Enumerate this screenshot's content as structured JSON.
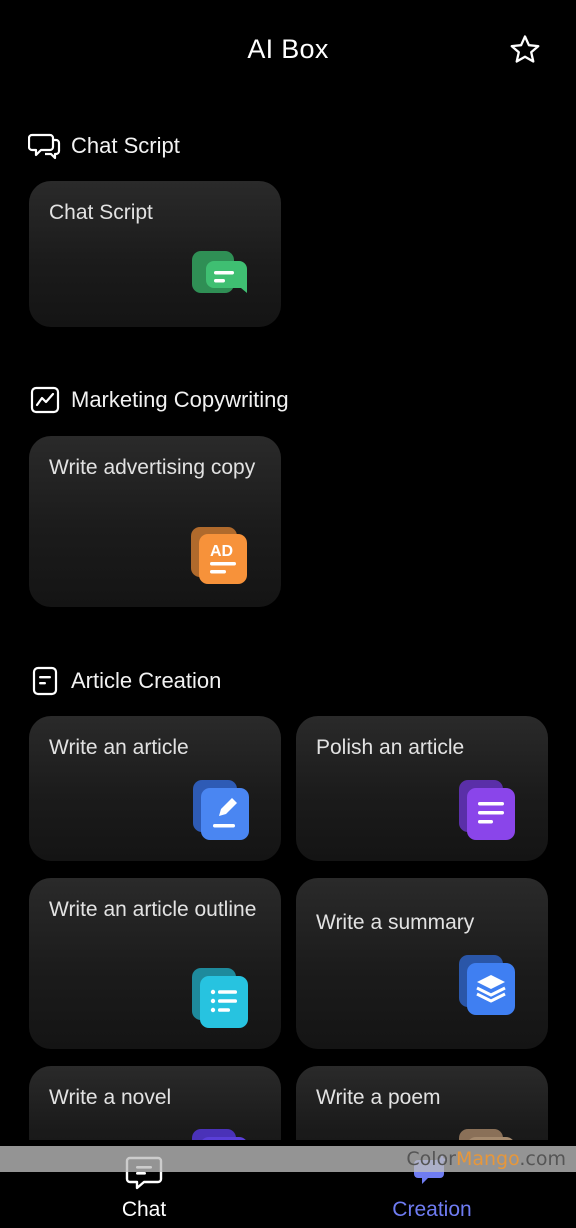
{
  "header": {
    "title": "AI Box",
    "favorite_icon": "star-icon"
  },
  "sections": [
    {
      "title": "Chat Script",
      "icon": "chat-bubbles-icon",
      "cards": [
        {
          "label": "Chat Script",
          "icon": "chat-script-icon",
          "color": "#3fbf72"
        }
      ]
    },
    {
      "title": "Marketing Copywriting",
      "icon": "trend-chart-icon",
      "cards": [
        {
          "label": "Write advertising copy",
          "icon": "ad-document-icon",
          "color": "#f7923a"
        }
      ]
    },
    {
      "title": "Article Creation",
      "icon": "document-icon",
      "cards": [
        {
          "label": "Write an article",
          "icon": "edit-document-icon",
          "color": "#4a86f2"
        },
        {
          "label": "Polish an article",
          "icon": "text-lines-icon",
          "color": "#8a45ea"
        },
        {
          "label": "Write an article outline",
          "icon": "list-icon",
          "color": "#27c3e0"
        },
        {
          "label": "Write a summary",
          "icon": "layers-icon",
          "color": "#3f7ff2"
        },
        {
          "label": "Write a novel",
          "icon": "novel-icon",
          "color": "#5a3fd8"
        },
        {
          "label": "Write a poem",
          "icon": "poem-icon",
          "color": "#a58a6e"
        }
      ]
    }
  ],
  "nav": {
    "items": [
      {
        "label": "Chat",
        "icon": "chat-icon",
        "active": false
      },
      {
        "label": "Creation",
        "icon": "creation-icon",
        "active": true
      }
    ],
    "active_color": "#6f7cf2",
    "inactive_color": "#ffffff"
  },
  "watermark": {
    "part1": "Color",
    "part2": "Mango",
    "part3": ".com"
  }
}
